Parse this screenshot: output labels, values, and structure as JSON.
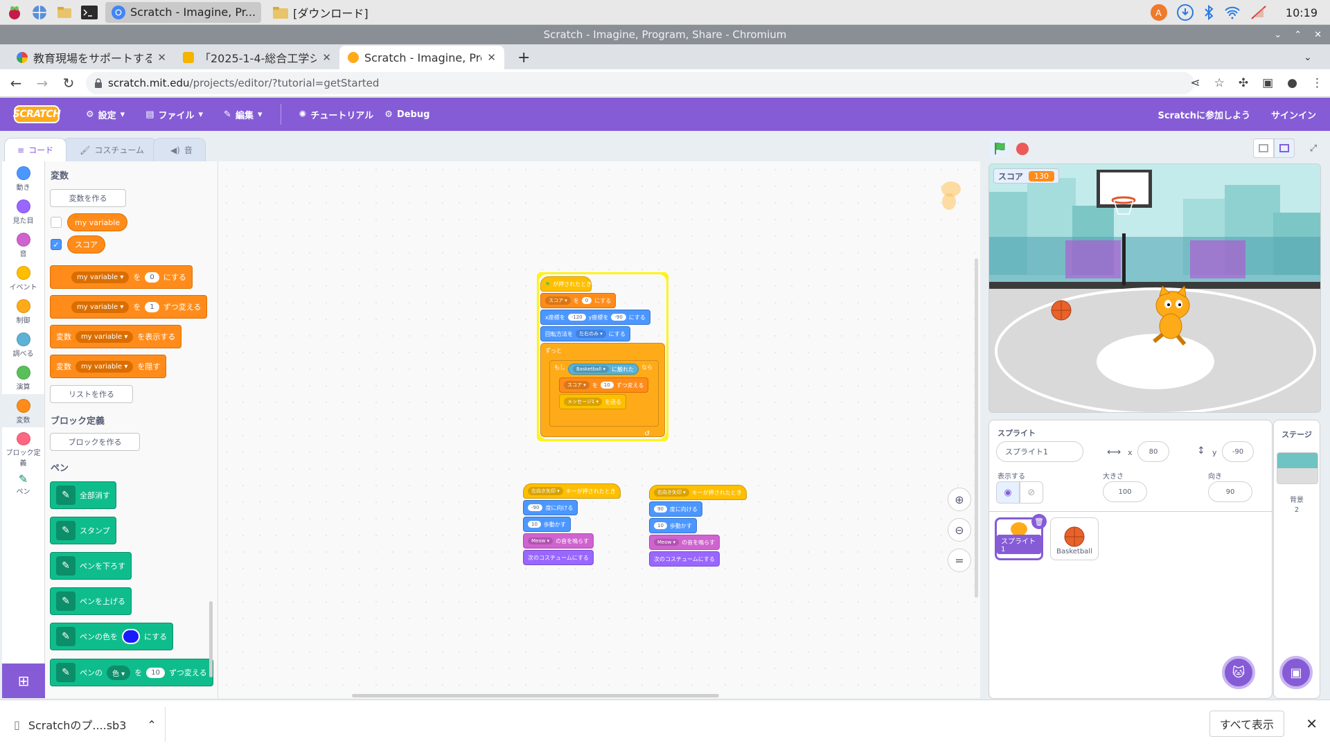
{
  "taskbar": {
    "tasks": [
      {
        "label": "Scratch - Imagine, Pr...",
        "icon": "chromium-icon"
      },
      {
        "label": "[ダウンロード]",
        "icon": "folder-icon"
      }
    ],
    "clock": "10:19"
  },
  "browser": {
    "window_title": "Scratch - Imagine, Program, Share - Chromium",
    "tabs": [
      {
        "label": "教育現場をサポートする",
        "icon": "google-icon"
      },
      {
        "label": "「2025-1-4-総合工学シ",
        "icon": "slides-icon"
      },
      {
        "label": "Scratch - Imagine, Progra",
        "icon": "scratch-icon"
      }
    ],
    "url_host": "scratch.mit.edu",
    "url_path": "/projects/editor/?tutorial=getStarted"
  },
  "menubar": {
    "logo": "SCRATCH",
    "settings": "設定",
    "file": "ファイル",
    "edit": "編集",
    "tutorial": "チュートリアル",
    "debug": "Debug",
    "join": "Scratchに参加しよう",
    "signin": "サインイン"
  },
  "editor_tabs": {
    "code": "コード",
    "costume": "コスチューム",
    "sound": "音"
  },
  "categories": [
    {
      "label": "動き",
      "color": "#4c97ff"
    },
    {
      "label": "見た目",
      "color": "#9966ff"
    },
    {
      "label": "音",
      "color": "#cf63cf"
    },
    {
      "label": "イベント",
      "color": "#ffbf00"
    },
    {
      "label": "制御",
      "color": "#ffab19"
    },
    {
      "label": "調べる",
      "color": "#5cb1d6"
    },
    {
      "label": "演算",
      "color": "#59c059"
    },
    {
      "label": "変数",
      "color": "#ff8c1a"
    },
    {
      "label": "ブロック定義",
      "color": "#ff6680"
    },
    {
      "label": "ペン",
      "color": "#0fbd8c"
    }
  ],
  "flyout": {
    "variables_title": "変数",
    "make_variable": "変数を作る",
    "var1": "my variable",
    "var2": "スコア",
    "set_to": "を",
    "set_suffix": "にする",
    "set_value": "0",
    "change_value": "1",
    "change_suffix": "ずつ変える",
    "show_prefix": "変数",
    "show_suffix": "を表示する",
    "hide_suffix": "を隠す",
    "make_list": "リストを作る",
    "myblocks_title": "ブロック定義",
    "make_block": "ブロックを作る",
    "pen_title": "ペン",
    "pen_clear": "全部消す",
    "pen_stamp": "スタンプ",
    "pen_down": "ペンを下ろす",
    "pen_up": "ペンを上げる",
    "pen_color_prefix": "ペンの色を",
    "pen_color_suffix": "にする",
    "pen_change_prefix": "ペンの",
    "pen_change_dd": "色",
    "pen_change_to": "を",
    "pen_change_value": "10",
    "pen_change_suffix": "ずつ変える"
  },
  "scripts": {
    "main": {
      "hat": "が押されたとき",
      "set_var": "スコア",
      "set_to": "を",
      "set_val": "0",
      "set_suffix": "にする",
      "goto_x_label": "x座標を",
      "goto_x": "-120",
      "goto_y_label": "y座標を",
      "goto_y": "-90",
      "goto_suffix": "にする",
      "rotation_label": "回転方法を",
      "rotation_dd": "左右のみ",
      "rotation_suffix": "にする",
      "forever": "ずっと",
      "if_label": "もし",
      "touch_dd": "Basketball",
      "touch_label": "に触れた",
      "then_label": "なら",
      "change_var": "スコア",
      "change_to": "を",
      "change_val": "10",
      "change_suffix": "ずつ変える",
      "broadcast_dd": "メッセージ1",
      "broadcast_suffix": "を送る"
    },
    "left": {
      "key_dd": "左向き矢印",
      "hat_suffix": "キーが押されたとき",
      "point_val": "-90",
      "point_suffix": "度に向ける",
      "move_val": "10",
      "move_suffix": "歩動かす",
      "sound_dd": "Meow",
      "sound_suffix": "の音を鳴らす",
      "next_costume": "次のコスチュームにする"
    },
    "right": {
      "key_dd": "右向き矢印",
      "hat_suffix": "キーが押されたとき",
      "point_val": "90",
      "point_suffix": "度に向ける",
      "move_val": "10",
      "move_suffix": "歩動かす",
      "sound_dd": "Meow",
      "sound_suffix": "の音を鳴らす",
      "next_costume": "次のコスチュームにする"
    }
  },
  "stage": {
    "monitor_label": "スコア",
    "monitor_value": "130"
  },
  "sprite_info": {
    "sprite_label": "スプライト",
    "sprite_name": "スプライト1",
    "x_label": "x",
    "x_value": "80",
    "y_label": "y",
    "y_value": "-90",
    "show_label": "表示する",
    "size_label": "大きさ",
    "size_value": "100",
    "direction_label": "向き",
    "direction_value": "90",
    "sprites": [
      "スプライト1",
      "Basketball"
    ]
  },
  "stage_pane": {
    "title": "ステージ",
    "backdrop_label": "背景",
    "backdrop_count": "2"
  },
  "download": {
    "filename": "Scratchのプ....sb3",
    "show_all": "すべて表示"
  }
}
